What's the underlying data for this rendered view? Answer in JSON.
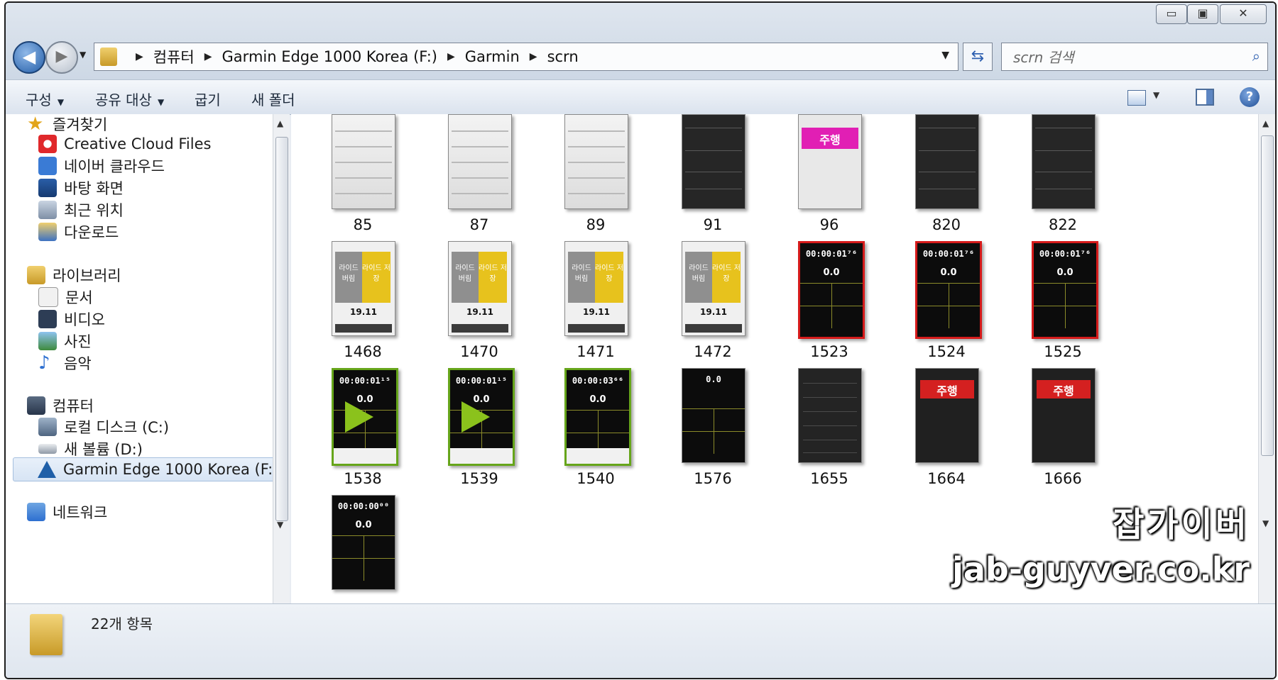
{
  "window": {
    "buttons": {
      "minimize": "▭",
      "maximize": "▣",
      "close": "✕"
    }
  },
  "address": {
    "crumbs": [
      "컴퓨터",
      "Garmin Edge 1000 Korea (F:)",
      "Garmin",
      "scrn"
    ]
  },
  "search": {
    "placeholder": "scrn 검색"
  },
  "toolbar": {
    "organize": "구성",
    "share": "공유 대상",
    "burn": "굽기",
    "new_folder": "새 폴더"
  },
  "sidebar": {
    "favorites": "즐겨찾기",
    "fav_items": [
      "Creative Cloud Files",
      "네이버 클라우드",
      "바탕 화면",
      "최근 위치",
      "다운로드"
    ],
    "libraries": "라이브러리",
    "lib_items": [
      "문서",
      "비디오",
      "사진",
      "음악"
    ],
    "computer": "컴퓨터",
    "comp_items": [
      "로컬 디스크 (C:)",
      "새 볼륨 (D:)",
      "Garmin Edge 1000 Korea (F:)"
    ],
    "network": "네트워크"
  },
  "files": [
    {
      "name": "85",
      "style": "light"
    },
    {
      "name": "87",
      "style": "light"
    },
    {
      "name": "89",
      "style": "light"
    },
    {
      "name": "91",
      "style": "dark"
    },
    {
      "name": "96",
      "style": "pink"
    },
    {
      "name": "820",
      "style": "dark"
    },
    {
      "name": "822",
      "style": "dark"
    },
    {
      "name": "1468",
      "style": "yellow"
    },
    {
      "name": "1470",
      "style": "yellow"
    },
    {
      "name": "1471",
      "style": "yellow"
    },
    {
      "name": "1472",
      "style": "yellow"
    },
    {
      "name": "1523",
      "style": "timer-red"
    },
    {
      "name": "1524",
      "style": "timer-red"
    },
    {
      "name": "1525",
      "style": "timer-red"
    },
    {
      "name": "1538",
      "style": "timer-green-play"
    },
    {
      "name": "1539",
      "style": "timer-green-play"
    },
    {
      "name": "1540",
      "style": "timer-green"
    },
    {
      "name": "1576",
      "style": "timer"
    },
    {
      "name": "1655",
      "style": "menu"
    },
    {
      "name": "1664",
      "style": "redbtn"
    },
    {
      "name": "1666",
      "style": "redbtn"
    },
    {
      "name": "",
      "style": "timer"
    }
  ],
  "thumb_text": {
    "timer": "00:00:01⁷⁶",
    "timer_green_1": "00:00:01¹⁵",
    "timer_green_3": "00:00:03⁶⁶",
    "timer_zero": "00:00:00⁰⁰",
    "speed": "0.0",
    "yellow_left": "라이드 버림",
    "yellow_right": "라이드 저장",
    "yellow_value": "19.11",
    "pink_button": "주행",
    "red_button": "주행"
  },
  "status": {
    "count": "22개 항목"
  },
  "watermark": {
    "korean": "잡가이버",
    "url": "jab-guyver.co.kr"
  },
  "colors": {
    "accent_pink": "#e11fb4",
    "accent_yellow": "#e7c21d",
    "accent_red": "#d61b1b",
    "accent_green": "#66a51a"
  }
}
